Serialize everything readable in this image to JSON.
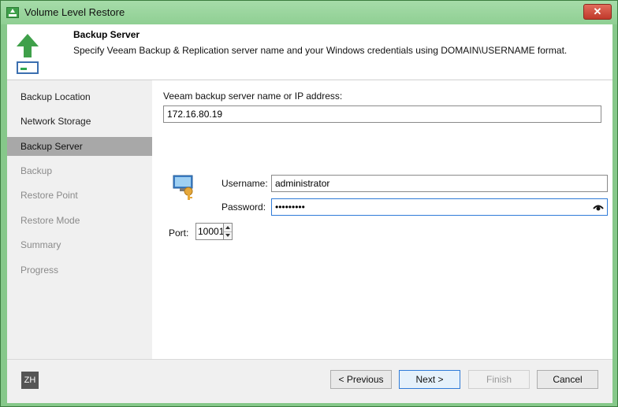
{
  "window": {
    "title": "Volume Level Restore",
    "close_label": "✕"
  },
  "header": {
    "title": "Backup Server",
    "subtitle": "Specify Veeam Backup & Replication server name and your Windows credentials using DOMAIN\\USERNAME format."
  },
  "sidebar": {
    "items": [
      {
        "label": "Backup Location",
        "state": "normal"
      },
      {
        "label": "Network Storage",
        "state": "normal"
      },
      {
        "label": "Backup Server",
        "state": "active"
      },
      {
        "label": "Backup",
        "state": "disabled"
      },
      {
        "label": "Restore Point",
        "state": "disabled"
      },
      {
        "label": "Restore Mode",
        "state": "disabled"
      },
      {
        "label": "Summary",
        "state": "disabled"
      },
      {
        "label": "Progress",
        "state": "disabled"
      }
    ]
  },
  "form": {
    "server_label": "Veeam backup server name or IP address:",
    "server_value": "172.16.80.19",
    "username_label": "Username:",
    "username_value": "administrator",
    "password_label": "Password:",
    "password_value": "•••••••••",
    "port_label": "Port:",
    "port_value": "10001"
  },
  "footer": {
    "language": "ZH",
    "previous_label": "< Previous",
    "next_label": "Next >",
    "finish_label": "Finish",
    "cancel_label": "Cancel"
  },
  "colors": {
    "title_bar": "#8fcf93",
    "active_item": "#a8a8a8",
    "focus_border": "#2f7bd8",
    "close_button": "#c0392b"
  },
  "icons": [
    "app-icon",
    "upload-arrow-icon",
    "credentials-key-icon",
    "eye-icon",
    "spinner-up-icon",
    "spinner-down-icon"
  ]
}
